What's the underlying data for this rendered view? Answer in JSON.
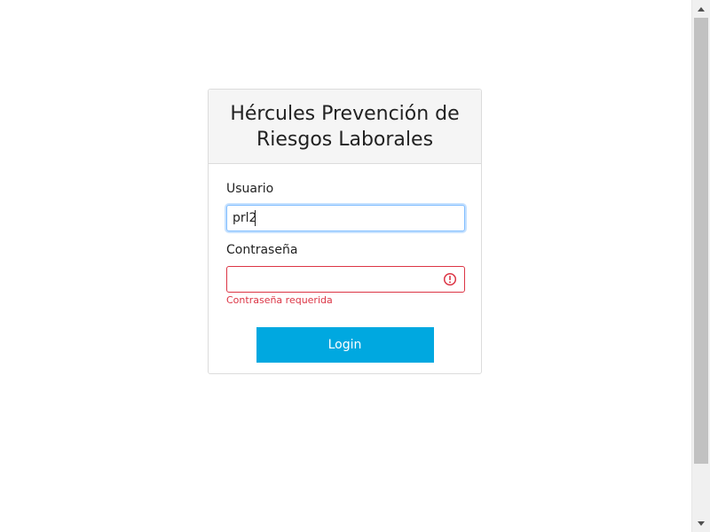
{
  "login": {
    "title": "Hércules Prevención de Riesgos Laborales",
    "username_label": "Usuario",
    "username_value": "prl2",
    "password_label": "Contraseña",
    "password_value": "",
    "password_error": "Contraseña requerida",
    "login_button": "Login"
  },
  "colors": {
    "accent": "#00a8e0",
    "error": "#dc3545",
    "focus": "#80bdff",
    "header_bg": "#f5f5f5"
  },
  "icons": {
    "password_error_icon": "exclamation-circle-icon",
    "scroll_up_icon": "triangle-up-icon",
    "scroll_down_icon": "triangle-down-icon"
  }
}
